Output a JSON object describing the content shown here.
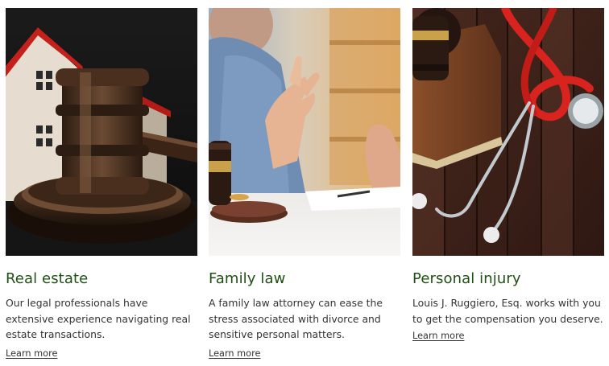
{
  "cards": [
    {
      "title": "Real estate",
      "description": "Our legal professionals have extensive experience navigating real estate transactions.",
      "link": "Learn more",
      "image": "gavel-and-house-photo"
    },
    {
      "title": "Family law",
      "description": "A family law attorney can ease the stress associated with divorce and sensitive personal matters.",
      "link": "Learn more",
      "image": "family-law-consultation-photo"
    },
    {
      "title": "Personal injury",
      "description": "Louis J. Ruggiero, Esq. works with you to get the compensation you deserve.",
      "link": "Learn more",
      "image": "stethoscope-gavel-book-photo"
    }
  ],
  "colors": {
    "title": "#1f4f14",
    "body_text": "#333333",
    "background": "#ffffff"
  }
}
